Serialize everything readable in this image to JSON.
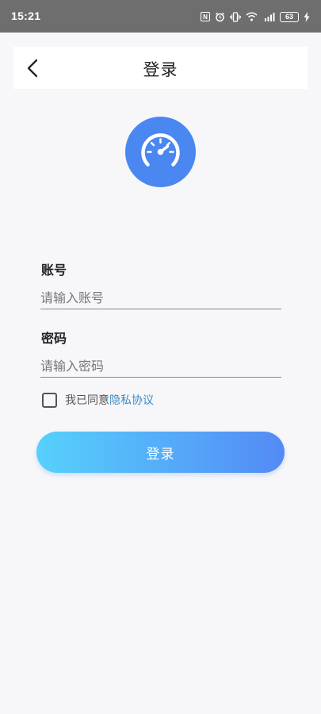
{
  "status_bar": {
    "time": "15:21",
    "battery": "63",
    "nfc": "N",
    "icons": [
      "nfc-icon",
      "alarm-icon",
      "vibrate-icon",
      "wifi-icon",
      "signal-5g-icon",
      "battery-icon",
      "charging-icon"
    ]
  },
  "header": {
    "title": "登录",
    "back_icon": "chevron-left-icon"
  },
  "logo": {
    "icon": "speedometer-icon",
    "color": "#4b87f1"
  },
  "form": {
    "account_label": "账号",
    "account_placeholder": "请输入账号",
    "account_value": "",
    "password_label": "密码",
    "password_placeholder": "请输入密码",
    "password_value": "",
    "agree_checked": false,
    "agree_text": "我已同意",
    "privacy_link": "隐私协议",
    "submit_label": "登录"
  },
  "colors": {
    "accent": "#4b87f1",
    "link": "#3a8cc8",
    "button_gradient_start": "#56d1fb",
    "button_gradient_end": "#548af6",
    "status_bar": "#6e6e6e",
    "background": "#f7f7f9"
  }
}
